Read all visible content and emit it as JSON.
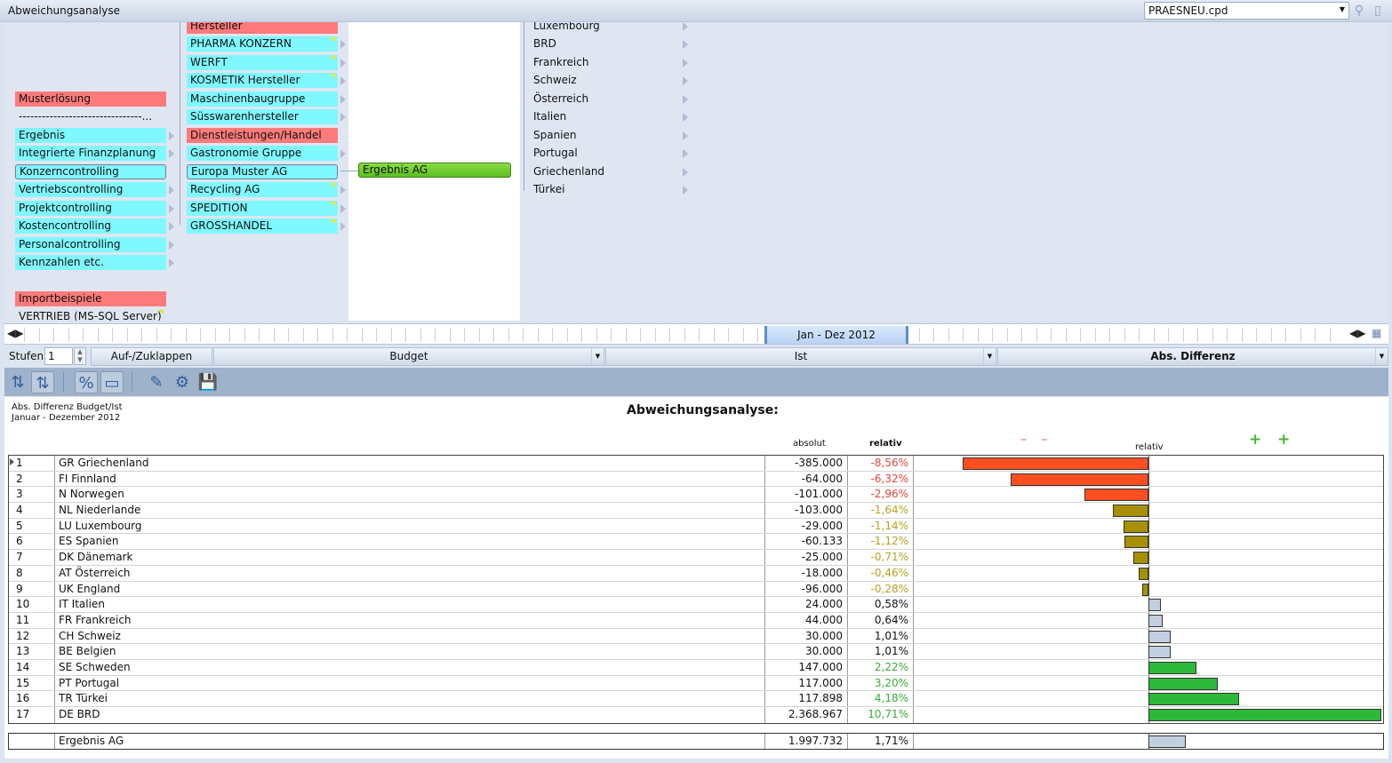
{
  "window": {
    "title": "Abweichungsanalyse",
    "file": "PRAESNEU.cpd"
  },
  "tree": {
    "col1": [
      {
        "label": "Musterlösung",
        "style": "red"
      },
      {
        "label": "--------------------------------...",
        "style": "plain"
      },
      {
        "label": "Ergebnis",
        "style": "cyan",
        "arrow": true
      },
      {
        "label": "Integrierte Finanzplanung",
        "style": "cyan",
        "arrow": true
      },
      {
        "label": "Konzerncontrolling",
        "style": "cyan sel"
      },
      {
        "label": "Vertriebscontrolling",
        "style": "cyan",
        "arrow": true
      },
      {
        "label": "Projektcontrolling",
        "style": "cyan",
        "arrow": true
      },
      {
        "label": "Kostencontrolling",
        "style": "cyan",
        "arrow": true
      },
      {
        "label": "Personalcontrolling",
        "style": "cyan",
        "arrow": true
      },
      {
        "label": "Kennzahlen etc.",
        "style": "cyan",
        "arrow": true
      },
      {
        "label": "Importbeispiele",
        "style": "red"
      },
      {
        "label": "VERTRIEB (MS-SQL Server)",
        "style": "plain",
        "flag": true
      }
    ],
    "col2": [
      {
        "label": "Hersteller",
        "style": "red"
      },
      {
        "label": "PHARMA KONZERN",
        "style": "cyan",
        "arrow": true,
        "flag": true
      },
      {
        "label": "WERFT",
        "style": "cyan",
        "arrow": true,
        "flag": true
      },
      {
        "label": "KOSMETIK Hersteller",
        "style": "cyan",
        "arrow": true,
        "flag": true
      },
      {
        "label": "Maschinenbaugruppe",
        "style": "cyan",
        "arrow": true
      },
      {
        "label": "Süsswarenhersteller",
        "style": "cyan",
        "arrow": true
      },
      {
        "label": "Dienstleistungen/Handel",
        "style": "red"
      },
      {
        "label": "Gastronomie Gruppe",
        "style": "cyan",
        "arrow": true
      },
      {
        "label": "Europa Muster AG",
        "style": "cyan sel"
      },
      {
        "label": "Recycling AG",
        "style": "cyan",
        "arrow": true,
        "flag": true
      },
      {
        "label": "SPEDITION",
        "style": "cyan",
        "arrow": true,
        "flag": true
      },
      {
        "label": "GROSSHANDEL",
        "style": "cyan",
        "arrow": true,
        "flag": true
      }
    ],
    "col3": [
      {
        "label": "Ergebnis AG",
        "style": "green"
      }
    ],
    "col4": [
      {
        "label": "Luxembourg"
      },
      {
        "label": "BRD"
      },
      {
        "label": "Frankreich"
      },
      {
        "label": "Schweiz"
      },
      {
        "label": "Österreich"
      },
      {
        "label": "Italien"
      },
      {
        "label": "Spanien"
      },
      {
        "label": "Portugal"
      },
      {
        "label": "Griechenland"
      },
      {
        "label": "Türkei"
      }
    ]
  },
  "timeline": {
    "range": "Jan - Dez 2012"
  },
  "controls": {
    "stufen_label": "Stufen:",
    "stufen_value": "1",
    "toggle_button": "Auf-/Zuklappen",
    "col_a": "Budget",
    "col_b": "Ist",
    "col_c": "Abs. Differenz"
  },
  "toolbar": {
    "tools": [
      {
        "name": "sort-ascending-icon",
        "glyph": "⇅",
        "pressed": false
      },
      {
        "name": "sort-descending-icon",
        "glyph": "⇅",
        "pressed": true
      },
      {
        "name": "percent-icon",
        "glyph": "%",
        "pressed": true
      },
      {
        "name": "bar-view-icon",
        "glyph": "▭",
        "pressed": true
      },
      {
        "name": "edit-icon",
        "glyph": "✎",
        "pressed": false
      },
      {
        "name": "settings-icon",
        "glyph": "⚙",
        "pressed": false
      },
      {
        "name": "save-icon",
        "glyph": "💾",
        "pressed": false
      }
    ]
  },
  "report": {
    "subtitle1": "Abs. Differenz Budget/Ist",
    "subtitle2": "Januar - Dezember 2012",
    "title": "Abweichungsanalyse:",
    "col_absolut": "absolut",
    "col_relativ": "relativ",
    "chart_label": "relativ",
    "minus_marks": "– –",
    "plus_marks": "+ +",
    "colors": {
      "strong_negative": "#ff4f20",
      "weak_negative": "#a69000",
      "neutral": "#c2cfe0",
      "positive": "#2db83a"
    },
    "total": {
      "name": "Ergebnis AG",
      "absolut": "1.997.732",
      "relativ": "1,71%",
      "value": 1.71
    }
  },
  "chart_data": {
    "type": "bar",
    "orientation": "horizontal",
    "xlabel": "relativ",
    "xlim": [
      -11,
      11
    ],
    "categories": [
      "GR Griechenland",
      "FI Finnland",
      "N Norwegen",
      "NL Niederlande",
      "LU Luxembourg",
      "ES Spanien",
      "DK Dänemark",
      "AT Österreich",
      "UK England",
      "IT Italien",
      "FR Frankreich",
      "CH Schweiz",
      "BE Belgien",
      "SE Schweden",
      "PT Portugal",
      "TR Türkei",
      "DE BRD"
    ],
    "rows": [
      {
        "no": "1",
        "name": "GR Griechenland",
        "absolut": "-385.000",
        "relativ": "-8,56%",
        "value": -8.56,
        "cls": "strong_negative"
      },
      {
        "no": "2",
        "name": "FI Finnland",
        "absolut": "-64.000",
        "relativ": "-6,32%",
        "value": -6.32,
        "cls": "strong_negative"
      },
      {
        "no": "3",
        "name": "N Norwegen",
        "absolut": "-101.000",
        "relativ": "-2,96%",
        "value": -2.96,
        "cls": "strong_negative"
      },
      {
        "no": "4",
        "name": "NL Niederlande",
        "absolut": "-103.000",
        "relativ": "-1,64%",
        "value": -1.64,
        "cls": "weak_negative"
      },
      {
        "no": "5",
        "name": "LU Luxembourg",
        "absolut": "-29.000",
        "relativ": "-1,14%",
        "value": -1.14,
        "cls": "weak_negative"
      },
      {
        "no": "6",
        "name": "ES Spanien",
        "absolut": "-60.133",
        "relativ": "-1,12%",
        "value": -1.12,
        "cls": "weak_negative"
      },
      {
        "no": "7",
        "name": "DK Dänemark",
        "absolut": "-25.000",
        "relativ": "-0,71%",
        "value": -0.71,
        "cls": "weak_negative"
      },
      {
        "no": "8",
        "name": "AT Österreich",
        "absolut": "-18.000",
        "relativ": "-0,46%",
        "value": -0.46,
        "cls": "weak_negative"
      },
      {
        "no": "9",
        "name": "UK England",
        "absolut": "-96.000",
        "relativ": "-0,28%",
        "value": -0.28,
        "cls": "weak_negative"
      },
      {
        "no": "10",
        "name": "IT Italien",
        "absolut": "24.000",
        "relativ": "0,58%",
        "value": 0.58,
        "cls": "neutral"
      },
      {
        "no": "11",
        "name": "FR Frankreich",
        "absolut": "44.000",
        "relativ": "0,64%",
        "value": 0.64,
        "cls": "neutral"
      },
      {
        "no": "12",
        "name": "CH Schweiz",
        "absolut": "30.000",
        "relativ": "1,01%",
        "value": 1.01,
        "cls": "neutral"
      },
      {
        "no": "13",
        "name": "BE Belgien",
        "absolut": "30.000",
        "relativ": "1,01%",
        "value": 1.01,
        "cls": "neutral"
      },
      {
        "no": "14",
        "name": "SE Schweden",
        "absolut": "147.000",
        "relativ": "2,22%",
        "value": 2.22,
        "cls": "positive"
      },
      {
        "no": "15",
        "name": "PT Portugal",
        "absolut": "117.000",
        "relativ": "3,20%",
        "value": 3.2,
        "cls": "positive"
      },
      {
        "no": "16",
        "name": "TR Türkei",
        "absolut": "117.898",
        "relativ": "4,18%",
        "value": 4.18,
        "cls": "positive"
      },
      {
        "no": "17",
        "name": "DE BRD",
        "absolut": "2.368.967",
        "relativ": "10,71%",
        "value": 10.71,
        "cls": "positive"
      }
    ]
  }
}
